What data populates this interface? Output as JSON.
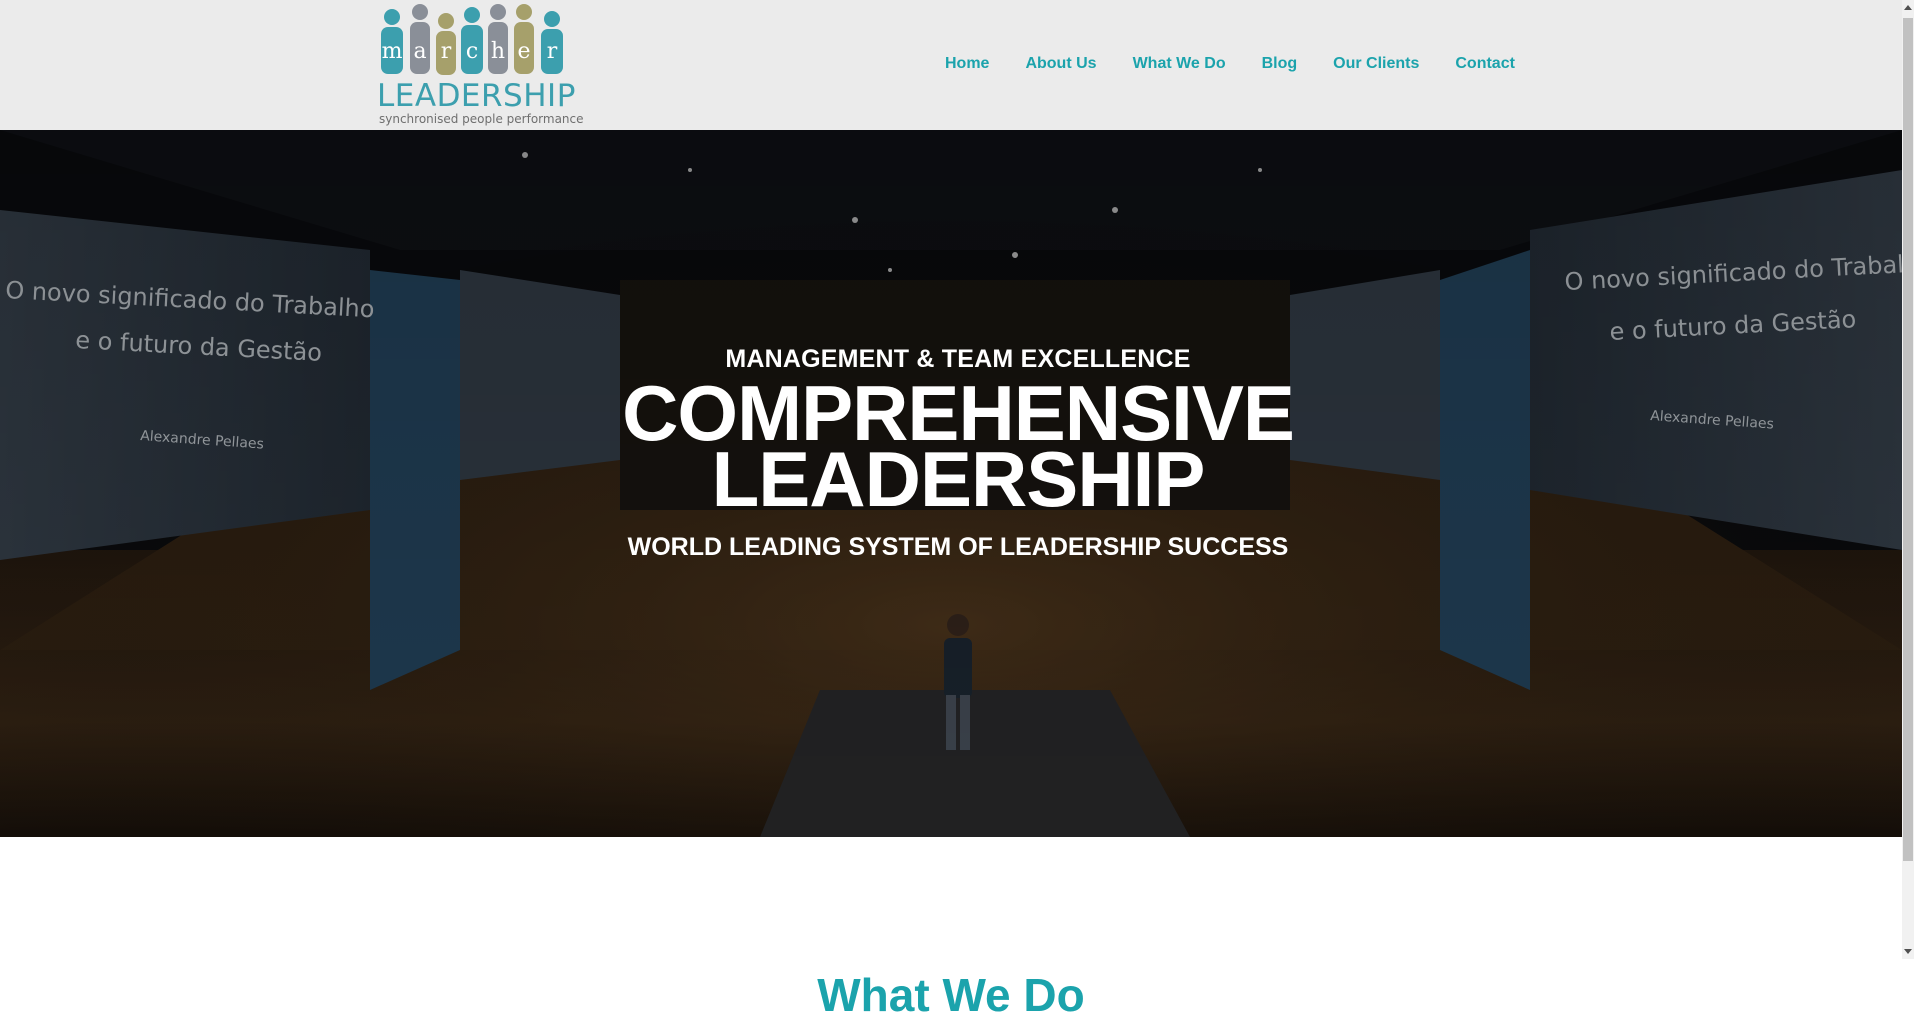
{
  "brand": {
    "logo_letters": [
      "m",
      "a",
      "r",
      "c",
      "h",
      "e",
      "r"
    ],
    "logo_word": "LEADERSHIP",
    "tagline": "synchronised people performance",
    "colors": {
      "teal": "#3c9fae",
      "gray": "#8a8f98",
      "olive": "#a6a06b"
    }
  },
  "nav": {
    "items": [
      {
        "label": "Home"
      },
      {
        "label": "About Us"
      },
      {
        "label": "What We Do"
      },
      {
        "label": "Blog"
      },
      {
        "label": "Our Clients"
      },
      {
        "label": "Contact"
      }
    ],
    "color": "#1ba3ac"
  },
  "hero": {
    "kicker": "MANAGEMENT & TEAM EXCELLENCE",
    "headline_line1": "COMPREHENSIVE",
    "headline_line2": "LEADERSHIP",
    "subheadline": "WORLD LEADING SYSTEM OF LEADERSHIP SUCCESS",
    "screen_text": {
      "line1": "O novo significado do Trabalho",
      "line2": "e o futuro da Gestão",
      "presenter": "Alexandre Pellaes"
    }
  },
  "section": {
    "title": "What We Do"
  }
}
